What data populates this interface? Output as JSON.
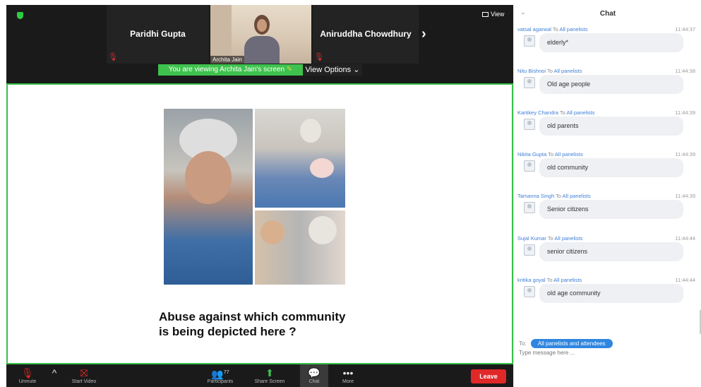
{
  "gallery": {
    "tiles": [
      {
        "name": "Paridhi Gupta"
      },
      {
        "name": "Aniruddha Chowdhury"
      }
    ],
    "video_caption": "Archita Jain",
    "view_label": "View"
  },
  "share_banner": {
    "viewing_text": "You are viewing Archita Jain's screen",
    "view_options_label": "View Options"
  },
  "slide": {
    "question_line1": "Abuse against which community",
    "question_line2": "is being depicted here ?"
  },
  "toolbar": {
    "unmute_label": "Unmute",
    "start_video_label": "Start Video",
    "participants_label": "Participants",
    "participants_count": "77",
    "share_screen_label": "Share Screen",
    "chat_label": "Chat",
    "more_label": "More",
    "leave_label": "Leave"
  },
  "chat": {
    "title": "Chat",
    "messages": [
      {
        "sender": "vatsal agarwal",
        "to": "To",
        "recipient": "All panelists",
        "time": "11:44:37",
        "text": "elderly*"
      },
      {
        "sender": "Nitu Bishnoi",
        "to": "To",
        "recipient": "All panelists",
        "time": "11:44:38",
        "text": "Old age people"
      },
      {
        "sender": "Kartikey Chandra",
        "to": "To",
        "recipient": "All panelists",
        "time": "11:44:39",
        "text": "old parents"
      },
      {
        "sender": "Nikita Gupta",
        "to": "To",
        "recipient": "All panelists",
        "time": "11:44:39",
        "text": "old community"
      },
      {
        "sender": "Tamanna Singh",
        "to": "To",
        "recipient": "All panelists",
        "time": "11:44:39",
        "text": "Senior citizens"
      },
      {
        "sender": "Sujal Kumar",
        "to": "To",
        "recipient": "All panelists",
        "time": "11:44:44",
        "text": "senior citizens"
      },
      {
        "sender": "kritika goyal",
        "to": "To",
        "recipient": "All panelists",
        "time": "11:44:44",
        "text": "old age community"
      }
    ],
    "to_label": "To:",
    "recipient_select": "All panelists and attendees",
    "input_placeholder": "Type message here ..."
  },
  "colors": {
    "share_green": "#3ec24d",
    "leave_red": "#e02828",
    "chat_link_blue": "#3f7fd6",
    "recipient_pill_blue": "#2e86e0"
  }
}
